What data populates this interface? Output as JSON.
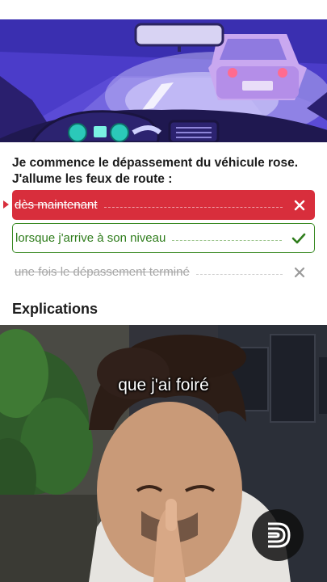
{
  "quiz": {
    "question_line1": "Je commence le dépassement du véhicule rose.",
    "question_line2": "J'allume les feux de route :",
    "answers": [
      {
        "text": "dès maintenant",
        "state": "wrong",
        "mark_icon": "cross-icon"
      },
      {
        "text": "lorsque j'arrive à son niveau",
        "state": "correct",
        "mark_icon": "check-icon"
      },
      {
        "text": "une fois le dépassement terminé",
        "state": "neutral",
        "mark_icon": "cross-icon"
      }
    ],
    "explications_heading": "Explications"
  },
  "video": {
    "subtitle": "que j'ai foiré",
    "logo_icon": "brand-d-logo-icon"
  },
  "colors": {
    "wrong": "#d82e3c",
    "correct": "#3a8a24",
    "neutral": "#a7a7a7",
    "illustration_sky": "#5a4bd4",
    "pink_car": "#c9a8f0"
  }
}
